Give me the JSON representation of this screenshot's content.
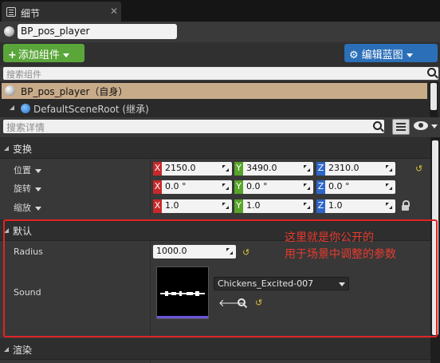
{
  "tab": {
    "title": "细节",
    "close": "✕"
  },
  "blueprint_name": "BP_pos_player",
  "toolbar": {
    "add_component_plus": "+",
    "add_component": "添加组件",
    "edit_blueprint": "编辑蓝图"
  },
  "component_search": {
    "placeholder": "搜索组件"
  },
  "components": [
    {
      "label": "BP_pos_player（自身）"
    },
    {
      "label": "DefaultSceneRoot (继承)"
    }
  ],
  "details_search": {
    "placeholder": "搜索详情"
  },
  "transform": {
    "header": "变换",
    "rows": [
      {
        "label": "位置",
        "x": "2150.0",
        "y": "3490.0",
        "z": "2310.0"
      },
      {
        "label": "旋转",
        "x": "0.0 °",
        "y": "0.0 °",
        "z": "0.0 °"
      },
      {
        "label": "缩放",
        "x": "1.0",
        "y": "1.0",
        "z": "1.0"
      }
    ],
    "axis_labels": {
      "x": "X",
      "y": "Y",
      "z": "Z"
    }
  },
  "defaults": {
    "header": "默认",
    "radius_label": "Radius",
    "radius_value": "1000.0",
    "sound_label": "Sound",
    "sound_asset": "Chickens_Excited-007"
  },
  "render": {
    "header": "渲染"
  },
  "annotation": {
    "line1": "这里就是你公开的",
    "line2": "用于场景中调整的参数"
  },
  "icons": {
    "reset": "↺",
    "back_arrow": "🡐"
  },
  "colors": {
    "add_button": "#5aa63a",
    "edit_button": "#2b6fb8",
    "axis_x": "#c6292a",
    "axis_y": "#58a52a",
    "axis_z": "#2d66c8",
    "annotation": "#e02424"
  }
}
